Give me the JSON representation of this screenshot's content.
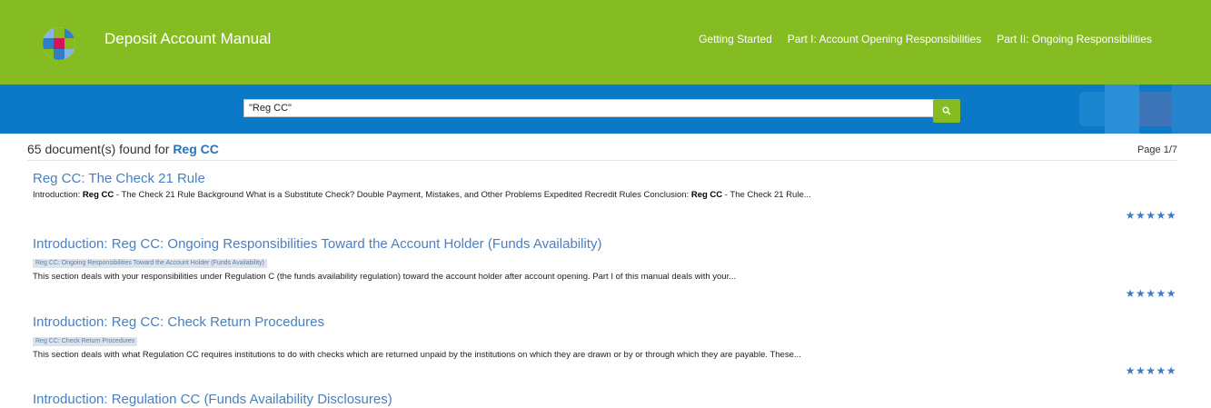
{
  "header": {
    "app_title": "Deposit Account Manual",
    "nav": [
      {
        "label": "Getting Started"
      },
      {
        "label": "Part I: Account Opening Responsibilities"
      },
      {
        "label": "Part II: Ongoing Responsibilities"
      }
    ],
    "logo_icon": "wolters-kluwer-logo",
    "colors": {
      "header_green": "#85bc22",
      "search_blue": "#0b79c8",
      "link_blue": "#4a7fc0",
      "star_blue": "#3d7bc4"
    }
  },
  "search": {
    "value": "\"Reg CC\"",
    "button_icon": "search-icon"
  },
  "results": {
    "count_text": "65 document(s) found for",
    "term": "Reg CC",
    "page_text": "Page 1/7",
    "items": [
      {
        "title": "Reg CC: The Check 21 Rule",
        "snippet": [
          {
            "text": "Introduction: ",
            "bold": false
          },
          {
            "text": "Reg CC",
            "bold": true
          },
          {
            "text": " - The Check 21 Rule Background What is a Substitute Check? Double Payment, Mistakes, and Other Problems Expedited Recredit Rules Conclusion: ",
            "bold": false
          },
          {
            "text": "Reg CC",
            "bold": true
          },
          {
            "text": " - The Check 21 Rule...",
            "bold": false
          }
        ],
        "rating": "★★★★★"
      },
      {
        "title": "Introduction: Reg CC: Ongoing Responsibilities Toward the Account Holder (Funds Availability)",
        "tag": "Reg CC: Ongoing Responsibilities Toward the Account Holder (Funds Availability)",
        "snippet": [
          {
            "text": "This section deals with your responsibilities under Regulation C (the funds availability regulation) toward the account holder after account opening. Part I of this manual deals with your...",
            "bold": false
          }
        ],
        "rating": "★★★★★"
      },
      {
        "title": "Introduction: Reg CC: Check Return Procedures",
        "tag": "Reg CC: Check Return Procedures",
        "snippet": [
          {
            "text": "This section deals with what Regulation CC requires institutions to do with checks which are returned unpaid by the institutions on which they are drawn or by or through which they are payable. These...",
            "bold": false
          }
        ],
        "rating": "★★★★★"
      },
      {
        "title": "Introduction: Regulation CC (Funds Availability Disclosures)"
      }
    ]
  }
}
